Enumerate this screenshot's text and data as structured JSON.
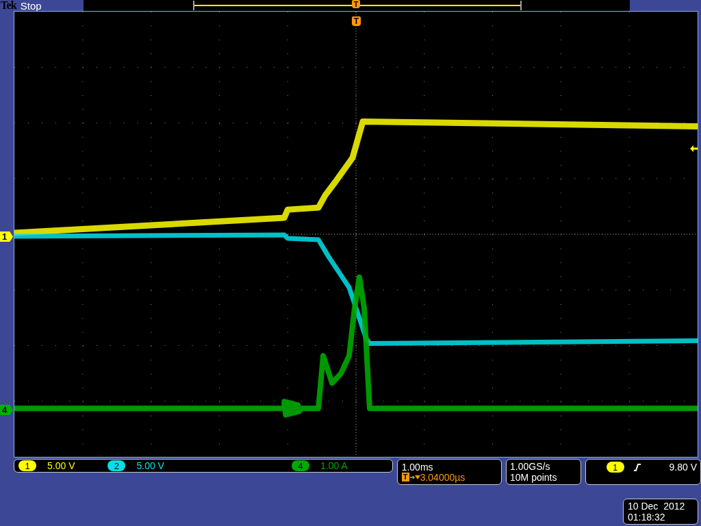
{
  "header": {
    "brand": "Tek",
    "status": "Stop"
  },
  "record_trigger_marker": "T",
  "graticule_trigger_marker": "T",
  "channel_markers": [
    {
      "label": "1",
      "color": "#ffff00"
    },
    {
      "label": "4",
      "color": "#00b000"
    }
  ],
  "channels": [
    {
      "number": "1",
      "scale": "5.00 V",
      "color": "#ffff00"
    },
    {
      "number": "2",
      "scale": "5.00 V",
      "color": "#00e0e8"
    },
    {
      "number": "4",
      "scale": "1.00 A",
      "color": "#00a800"
    }
  ],
  "timebase": {
    "scale": "1.00ms",
    "trigger_marker": "T",
    "delay": "3.04000µs"
  },
  "acquisition": {
    "sample_rate": "1.00GS/s",
    "record_length": "10M points"
  },
  "trigger": {
    "source": "1",
    "color": "#ffff00",
    "level": "9.80 V"
  },
  "datetime": {
    "date": "10 Dec  2012",
    "time": "01:18:32"
  }
}
